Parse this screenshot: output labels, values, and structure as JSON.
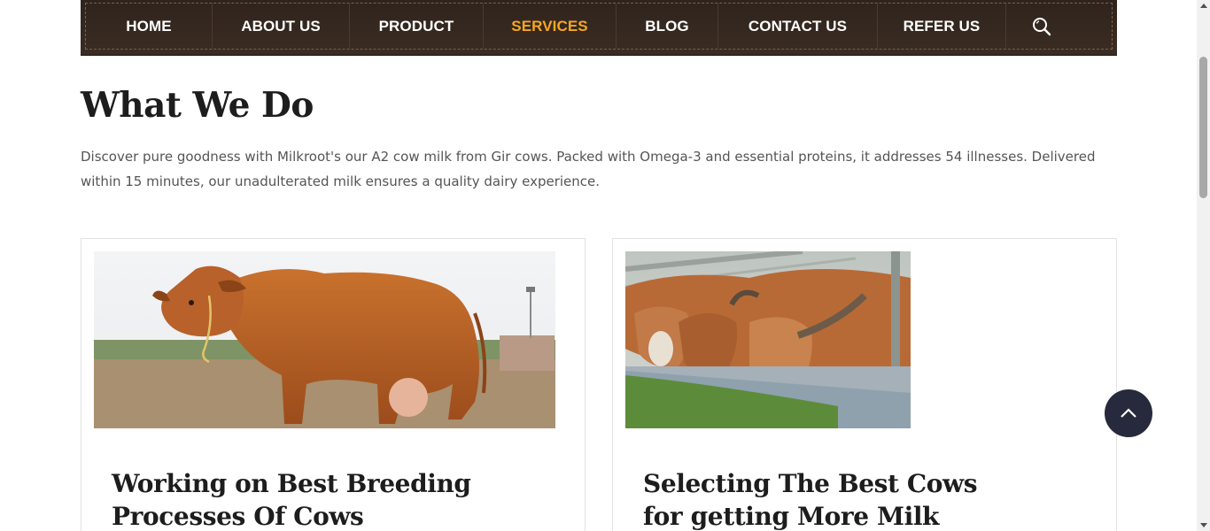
{
  "nav": {
    "items": [
      {
        "label": "HOME",
        "active": false
      },
      {
        "label": "ABOUT US",
        "active": false
      },
      {
        "label": "PRODUCT",
        "active": false
      },
      {
        "label": "SERVICES",
        "active": true
      },
      {
        "label": "BLOG",
        "active": false
      },
      {
        "label": "CONTACT US",
        "active": false
      },
      {
        "label": "REFER US",
        "active": false
      }
    ],
    "search_icon": "search-icon"
  },
  "section": {
    "title": "What We Do",
    "intro": "Discover pure goodness with Milkroot's our A2 cow milk from Gir cows. Packed with Omega-3 and essential proteins, it addresses 54 illnesses. Delivered within 15 minutes, our unadulterated milk ensures a quality dairy experience."
  },
  "cards": [
    {
      "title": "Working on Best Breeding Processes Of Cows"
    },
    {
      "title": "Selecting The Best Cows for getting More Milk"
    }
  ],
  "colors": {
    "nav_bg": "#2f241d",
    "active": "#f5a623",
    "scroll_button": "#262a3c"
  },
  "scroll_top_icon": "chevron-up-icon"
}
